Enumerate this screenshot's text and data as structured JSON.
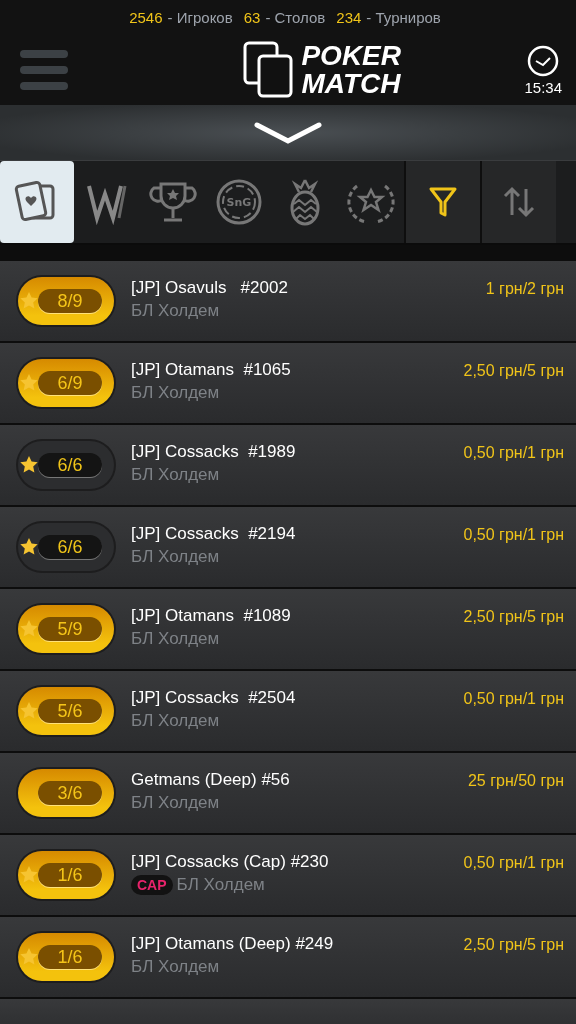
{
  "stats": [
    {
      "count": "2546",
      "label": "- Игроков"
    },
    {
      "count": "63",
      "label": "- Столов"
    },
    {
      "count": "234",
      "label": "- Турниров"
    }
  ],
  "header": {
    "logo_line1": "POKER",
    "logo_line2": "MATCH",
    "time": "15:34"
  },
  "tabs": [
    {
      "kind": "cards",
      "selected": true
    },
    {
      "kind": "w",
      "selected": false
    },
    {
      "kind": "trophy",
      "selected": false
    },
    {
      "kind": "sng",
      "label": "SnG",
      "selected": false
    },
    {
      "kind": "pineapple",
      "selected": false
    },
    {
      "kind": "laurel",
      "selected": false
    }
  ],
  "tables": [
    {
      "seats": "8/9",
      "full": false,
      "starred": true,
      "name": "[JP] Osavuls   #2002",
      "game": "БЛ Холдем",
      "stakes": "1 грн/2 грн"
    },
    {
      "seats": "6/9",
      "full": false,
      "starred": true,
      "name": "[JP] Otamans  #1065",
      "game": "БЛ Холдем",
      "stakes": "2,50 грн/5 грн"
    },
    {
      "seats": "6/6",
      "full": true,
      "starred": true,
      "name": "[JP] Cossacks  #1989",
      "game": "БЛ Холдем",
      "stakes": "0,50 грн/1 грн"
    },
    {
      "seats": "6/6",
      "full": true,
      "starred": true,
      "name": "[JP] Cossacks  #2194",
      "game": "БЛ Холдем",
      "stakes": "0,50 грн/1 грн"
    },
    {
      "seats": "5/9",
      "full": false,
      "starred": true,
      "name": "[JP] Otamans  #1089",
      "game": "БЛ Холдем",
      "stakes": "2,50 грн/5 грн"
    },
    {
      "seats": "5/6",
      "full": false,
      "starred": true,
      "name": "[JP] Cossacks  #2504",
      "game": "БЛ Холдем",
      "stakes": "0,50 грн/1 грн"
    },
    {
      "seats": "3/6",
      "full": false,
      "starred": false,
      "name": "Getmans (Deep) #56",
      "game": "БЛ Холдем",
      "stakes": "25 грн/50 грн"
    },
    {
      "seats": "1/6",
      "full": false,
      "starred": true,
      "name": "[JP] Cossacks (Cap) #230",
      "tag": "CAP",
      "game": "БЛ Холдем",
      "stakes": "0,50 грн/1 грн"
    },
    {
      "seats": "1/6",
      "full": false,
      "starred": true,
      "name": "[JP] Otamans (Deep) #249",
      "game": "БЛ Холдем",
      "stakes": "2,50 грн/5 грн"
    }
  ]
}
